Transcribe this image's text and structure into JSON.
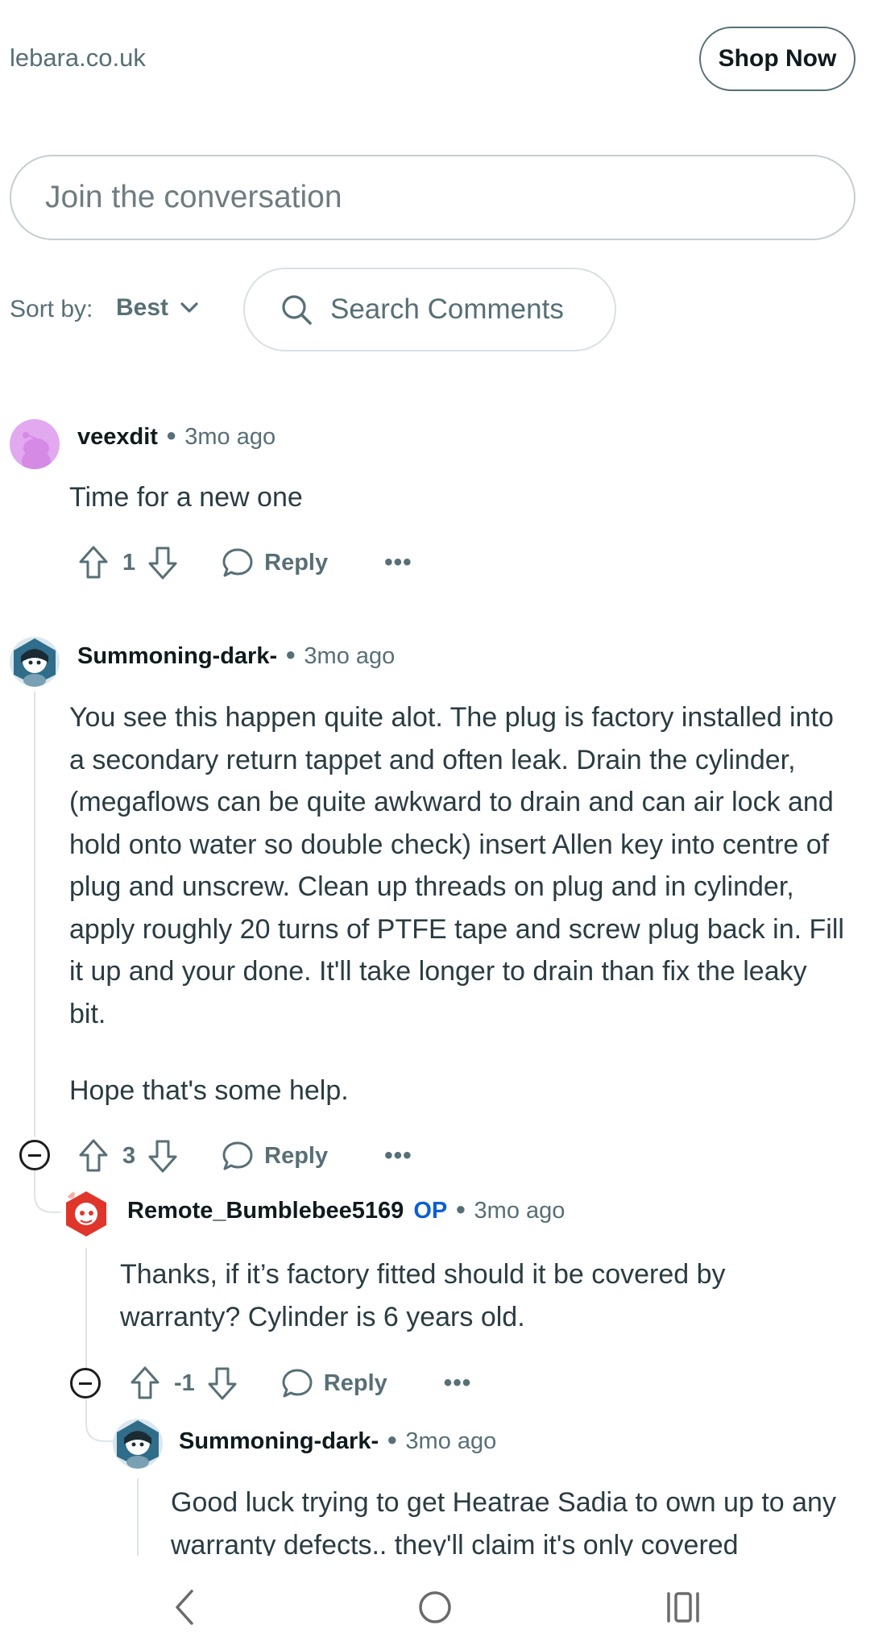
{
  "ad": {
    "domain": "lebara.co.uk",
    "cta": "Shop Now"
  },
  "composer": {
    "placeholder": "Join the conversation"
  },
  "sort": {
    "label": "Sort by:",
    "value": "Best",
    "search_label": "Search Comments"
  },
  "comments": [
    {
      "author": "veexdit",
      "time": "3mo ago",
      "body": "Time for a new one",
      "score": "1",
      "reply_label": "Reply"
    },
    {
      "author": "Summoning-dark-",
      "time": "3mo ago",
      "body": "You see this happen quite alot. The plug is factory installed into a secondary return tappet and often leak. Drain the cylinder, (megaflows can be quite awkward to drain and can air lock and hold onto water so double check) insert Allen key into centre of plug and unscrew. Clean up threads on plug and in cylinder, apply roughly 20 turns of PTFE tape and screw plug back in. Fill it up and your done. It'll take longer to drain than fix the leaky bit.",
      "body2": "Hope that's some help.",
      "score": "3",
      "reply_label": "Reply"
    },
    {
      "author": "Remote_Bumblebee5169",
      "op_badge": "OP",
      "time": "3mo ago",
      "body": "Thanks, if it’s factory fitted should it be covered by warranty? Cylinder is 6 years old.",
      "score": "-1",
      "reply_label": "Reply"
    },
    {
      "author": "Summoning-dark-",
      "time": "3mo ago",
      "body": "Good luck trying to get Heatrae Sadia to own up to any warranty defects.. they'll claim it's only covered"
    }
  ],
  "icons": {
    "upvote": "upvote-icon",
    "downvote": "downvote-icon",
    "reply": "comment-bubble-icon",
    "more": "more-icon",
    "search": "search-icon",
    "chevron": "chevron-down-icon",
    "collapse": "collapse-icon",
    "back": "back-icon",
    "home": "home-icon",
    "recents": "recents-icon"
  },
  "colors": {
    "meta": "#576f76",
    "op": "#0a5fd1",
    "avatar_purple": "#e2a8f0"
  }
}
